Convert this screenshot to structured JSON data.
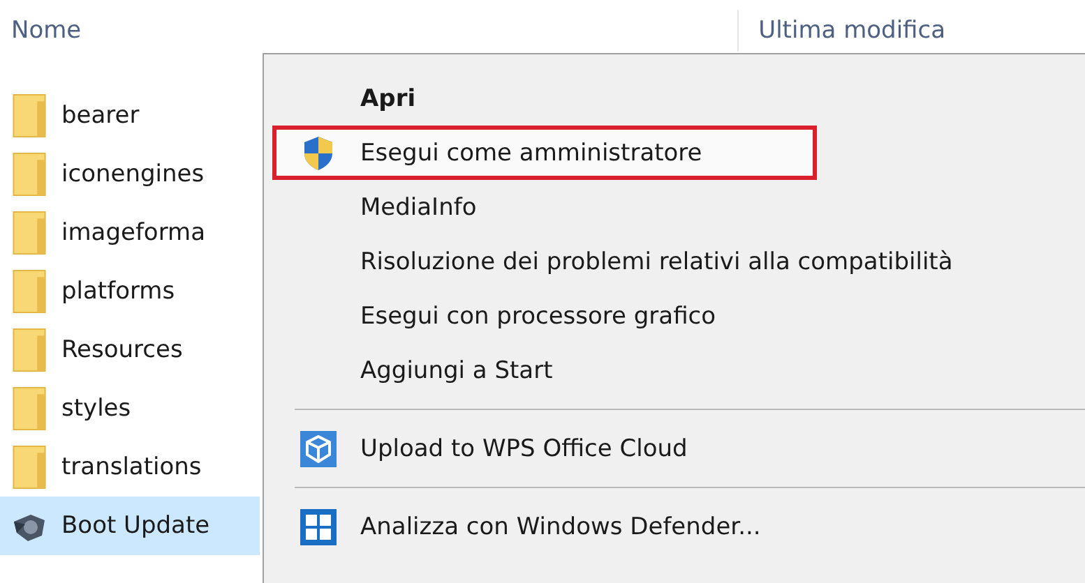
{
  "columns": [
    "Nome",
    "Ultima modifica"
  ],
  "files": [
    {
      "name": "bearer",
      "kind": "folder",
      "selected": false
    },
    {
      "name": "iconengines",
      "kind": "folder",
      "selected": false
    },
    {
      "name": "imageforma",
      "kind": "folder",
      "selected": false
    },
    {
      "name": "platforms",
      "kind": "folder",
      "selected": false
    },
    {
      "name": "Resources",
      "kind": "folder",
      "selected": false
    },
    {
      "name": "styles",
      "kind": "folder",
      "selected": false
    },
    {
      "name": "translations",
      "kind": "folder",
      "selected": false
    },
    {
      "name": "Boot Update",
      "kind": "app",
      "selected": true
    }
  ],
  "context_menu": [
    {
      "kind": "default",
      "label": "Apri",
      "highlighted": false
    },
    {
      "kind": "elevated",
      "label": "Esegui come amministratore",
      "highlighted": true
    },
    {
      "kind": "plain",
      "label": "MediaInfo",
      "highlighted": false
    },
    {
      "kind": "plain",
      "label": "Risoluzione dei problemi relativi alla compatibilità",
      "highlighted": false
    },
    {
      "kind": "plain",
      "label": "Esegui con processore grafico",
      "highlighted": false
    },
    {
      "kind": "plain",
      "label": "Aggiungi a Start",
      "highlighted": false
    },
    {
      "kind": "separator"
    },
    {
      "kind": "cloud",
      "label": "Upload to WPS Office Cloud",
      "highlighted": false
    },
    {
      "kind": "separator"
    },
    {
      "kind": "scan",
      "label": "Analizza con Windows Defender...",
      "highlighted": false
    }
  ]
}
